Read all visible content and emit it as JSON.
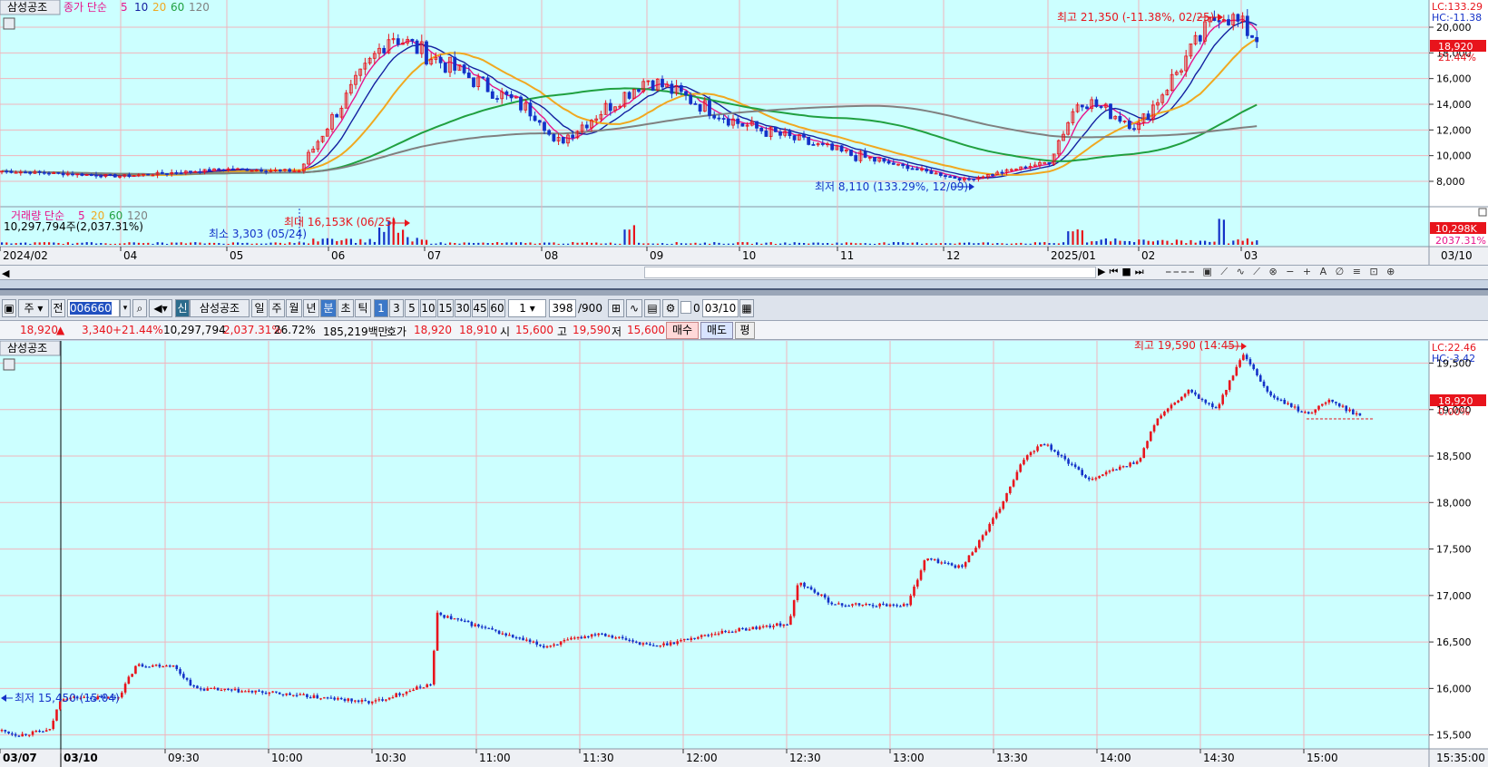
{
  "top": {
    "title": "삼성공조",
    "legend": {
      "label": "종가 단순",
      "p5": "5",
      "p10": "10",
      "p20": "20",
      "p60": "60",
      "p120": "120"
    },
    "lc": "LC:133.29",
    "hc": "HC:-11.38",
    "price_tag": "18,920",
    "pct_tag": "21.44%",
    "yticks": [
      "20,000",
      "18,000",
      "16,000",
      "14,000",
      "12,000",
      "10,000",
      "8,000"
    ],
    "max_note": "최고 21,350 (-11.38%, 02/25)",
    "min_note": "최저 8,110 (133.29%, 12/09)",
    "vol_legend": {
      "label": "거래량 단순",
      "p5": "5",
      "p20": "20",
      "p60": "60",
      "p120": "120"
    },
    "vol_value": "10,297,794주(2,037.31%)",
    "vol_max_note": "최대 16,153K (06/25)",
    "vol_min_note": "최소 3,303 (05/24)",
    "vol_tag": "10,298K",
    "vol_pct_tag": "2037.31%",
    "xlabels": [
      "2024/02",
      "04",
      "05",
      "06",
      "07",
      "08",
      "09",
      "10",
      "11",
      "12",
      "2025/01",
      "02",
      "03"
    ],
    "x_right": "03/10"
  },
  "toolbar": {
    "unit": "주",
    "mode": "전",
    "code": "006660",
    "badge": "신",
    "name": "삼성공조",
    "periods": [
      "일",
      "주",
      "월",
      "년",
      "분",
      "초",
      "틱"
    ],
    "intervals": [
      "1",
      "3",
      "5",
      "10",
      "15",
      "30",
      "45",
      "60"
    ],
    "count_sel": "1",
    "count": "398",
    "count_max": "/900",
    "zero": "0",
    "date": "03/10"
  },
  "quote": {
    "price": "18,920",
    "arrow": "▲",
    "change": "3,340",
    "rate": "+21.44%",
    "volume": "10,297,794",
    "vol_rate": "2,037.31%",
    "turnover": "26.72%",
    "amount": "185,219백만",
    "bid_label": "호가",
    "ask": "18,920",
    "bid": "18,910",
    "open_label": "시",
    "open": "15,600",
    "high_label": "고",
    "high": "19,590",
    "low_label": "저",
    "low": "15,600",
    "buy": "매수",
    "sell": "매도",
    "eval": "평"
  },
  "bottom": {
    "title": "삼성공조",
    "lc": "LC:22.46",
    "hc": "HC:-3.42",
    "price_tag": "18,920",
    "pct_tag": "0.00%",
    "max_note": "최고 19,590 (14:45)",
    "min_note": "최저 15,450 (15:04)",
    "yticks": [
      "19,500",
      "19,000",
      "18,500",
      "18,000",
      "17,500",
      "17,000",
      "16,500",
      "16,000",
      "15,500"
    ],
    "xlabels": [
      "03/07",
      "03/10",
      "09:30",
      "10:00",
      "10:30",
      "11:00",
      "11:30",
      "12:00",
      "12:30",
      "13:00",
      "13:30",
      "14:00",
      "14:30",
      "15:00"
    ],
    "x_right": "15:35:00"
  },
  "colors": {
    "bg": "#ccffff",
    "up": "#e8141c",
    "down": "#1432c8",
    "ma5": "#e8148c",
    "ma10": "#1420a0",
    "ma20": "#f0a820",
    "ma60": "#20a040",
    "ma120": "#808080"
  },
  "chart_data": [
    {
      "type": "candlestick",
      "title": "삼성공조",
      "period": "daily",
      "x_range": [
        "2024/02",
        "2025/03/10"
      ],
      "ylim": [
        7500,
        21000
      ],
      "moving_averages": [
        5,
        10,
        20,
        60,
        120
      ],
      "close_path": [
        {
          "x": "2024/02",
          "y": 8800
        },
        {
          "x": "2024/04",
          "y": 8400
        },
        {
          "x": "2024/05",
          "y": 8950
        },
        {
          "x": "2024/05/24",
          "y": 8800
        },
        {
          "x": "2024/06",
          "y": 12500
        },
        {
          "x": "2024/06/25",
          "y": 19500
        },
        {
          "x": "2024/07",
          "y": 18000
        },
        {
          "x": "2024/08",
          "y": 13000
        },
        {
          "x": "2024/08/05",
          "y": 10800
        },
        {
          "x": "2024/09",
          "y": 16000
        },
        {
          "x": "2024/10",
          "y": 12500
        },
        {
          "x": "2024/11",
          "y": 10300
        },
        {
          "x": "2024/12/09",
          "y": 8110
        },
        {
          "x": "2025/01",
          "y": 9500
        },
        {
          "x": "2025/01/10",
          "y": 14500
        },
        {
          "x": "2025/02",
          "y": 12300
        },
        {
          "x": "2025/02/25",
          "y": 21350
        },
        {
          "x": "2025/03/10",
          "y": 18920
        }
      ],
      "volume_max": "16,153K (06/25)",
      "volume_min": "3,303 (05/24)",
      "volume_last": "10,298K"
    },
    {
      "type": "candlestick",
      "title": "삼성공조",
      "period": "1min",
      "date": "03/10",
      "ylim": [
        15350,
        19700
      ],
      "open": 15600,
      "high": 19590,
      "low": 15450,
      "close": 18920,
      "close_path": [
        {
          "x": "03/07 close",
          "y": 15550
        },
        {
          "x": "09:00",
          "y": 15900
        },
        {
          "x": "09:15",
          "y": 16250
        },
        {
          "x": "09:30",
          "y": 16050
        },
        {
          "x": "10:00",
          "y": 15950
        },
        {
          "x": "10:30",
          "y": 15900
        },
        {
          "x": "10:50",
          "y": 16800
        },
        {
          "x": "11:00",
          "y": 16600
        },
        {
          "x": "11:30",
          "y": 16600
        },
        {
          "x": "12:00",
          "y": 16550
        },
        {
          "x": "12:30",
          "y": 16700
        },
        {
          "x": "12:45",
          "y": 17150
        },
        {
          "x": "13:00",
          "y": 16900
        },
        {
          "x": "13:15",
          "y": 17400
        },
        {
          "x": "13:30",
          "y": 17600
        },
        {
          "x": "13:45",
          "y": 18650
        },
        {
          "x": "14:00",
          "y": 18250
        },
        {
          "x": "14:15",
          "y": 18950
        },
        {
          "x": "14:45",
          "y": 19590
        },
        {
          "x": "15:00",
          "y": 18950
        },
        {
          "x": "15:20",
          "y": 18920
        }
      ]
    }
  ]
}
